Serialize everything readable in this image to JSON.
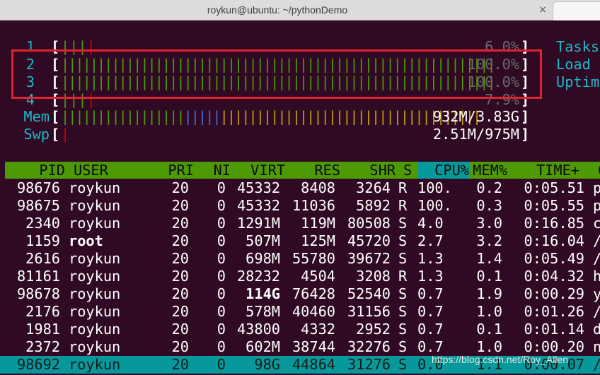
{
  "window": {
    "title": "roykun@ubuntu: ~/pythonDemo",
    "close_glyph": "×"
  },
  "meters": [
    {
      "label": "1",
      "bars_green": "|||",
      "bars_red": "|",
      "bars_blue": "",
      "bars_yellow": "",
      "value": "6.0%",
      "bright": false,
      "side": "Tasks"
    },
    {
      "label": "2",
      "bars_green": "||||||||||||||||||||||||||||||||||||||||||||||||||||||||||||",
      "bars_red": "",
      "bars_blue": "",
      "bars_yellow": "",
      "value": "100.0%",
      "bright": false,
      "side": "Load"
    },
    {
      "label": "3",
      "bars_green": "||||||||||||||||||||||||||||||||||||||||||||||||||||||||||||",
      "bars_red": "",
      "bars_blue": "",
      "bars_yellow": "",
      "value": "100.0%",
      "bright": false,
      "side": "Uptim"
    },
    {
      "label": "4",
      "bars_green": "|||",
      "bars_red": "|",
      "bars_blue": "",
      "bars_yellow": "",
      "value": "7.9%",
      "bright": false,
      "side": ""
    },
    {
      "label": "Mem",
      "bars_green": "|||||||||||||||||",
      "bars_red": "",
      "bars_blue": "|||||",
      "bars_yellow": "||||||||||||||||||||||||||||||||||||",
      "value": "932M/3.83G",
      "bright": true,
      "side": ""
    },
    {
      "label": "Swp",
      "bars_green": "",
      "bars_red": "|",
      "bars_blue": "",
      "bars_yellow": "",
      "value": "2.51M/975M",
      "bright": true,
      "side": ""
    }
  ],
  "columns": {
    "pid": "PID",
    "user": "USER",
    "pri": "PRI",
    "ni": "NI",
    "virt": "VIRT",
    "res": "RES",
    "shr": "SHR",
    "s": "S",
    "cpu": "CPU%",
    "mem": "MEM%",
    "time": "TIME+",
    "cmd": "C"
  },
  "processes": [
    {
      "pid": "98676",
      "user": "roykun",
      "pri": "20",
      "ni": "0",
      "virt_a": "45",
      "virt_b": "332",
      "res_a": "8",
      "res_b": "408",
      "shr_a": "3",
      "shr_b": "264",
      "s": "R",
      "cpu": "100.",
      "mem": "0.2",
      "time": "0:05.51",
      "cmd": "p"
    },
    {
      "pid": "98675",
      "user": "roykun",
      "pri": "20",
      "ni": "0",
      "virt_a": "45",
      "virt_b": "332",
      "res_a": "11",
      "res_b": "036",
      "shr_a": "5",
      "shr_b": "892",
      "s": "R",
      "cpu": "100.",
      "mem": "0.3",
      "time": "0:05.55",
      "cmd": "p"
    },
    {
      "pid": "2340",
      "user": "roykun",
      "pri": "20",
      "ni": "0",
      "virt_a": "1291M",
      "virt_b": "",
      "res_a": "119M",
      "res_b": "",
      "shr_a": "80",
      "shr_b": "508",
      "s": "S",
      "cpu": "4.0",
      "mem": "3.0",
      "time": "0:16.85",
      "cmd": "c"
    },
    {
      "pid": "1159",
      "user": "root",
      "pri": "20",
      "ni": "0",
      "virt_a": "507M",
      "virt_b": "",
      "res_a": "125M",
      "res_b": "",
      "shr_a": "45",
      "shr_b": "720",
      "s": "S",
      "cpu": "2.7",
      "mem": "3.2",
      "time": "0:16.04",
      "cmd": "/"
    },
    {
      "pid": "2616",
      "user": "roykun",
      "pri": "20",
      "ni": "0",
      "virt_a": "698M",
      "virt_b": "",
      "res_a": "55",
      "res_b": "780",
      "shr_a": "39",
      "shr_b": "672",
      "s": "S",
      "cpu": "1.3",
      "mem": "1.4",
      "time": "0:05.49",
      "cmd": "/"
    },
    {
      "pid": "81161",
      "user": "roykun",
      "pri": "20",
      "ni": "0",
      "virt_a": "28",
      "virt_b": "232",
      "res_a": "4",
      "res_b": "504",
      "shr_a": "3",
      "shr_b": "208",
      "s": "R",
      "cpu": "1.3",
      "mem": "0.1",
      "time": "0:04.32",
      "cmd": "h"
    },
    {
      "pid": "98678",
      "user": "roykun",
      "pri": "20",
      "ni": "0",
      "virt_a": "114G",
      "virt_b": "",
      "res_a": "76",
      "res_b": "428",
      "shr_a": "52",
      "shr_b": "540",
      "s": "S",
      "cpu": "0.7",
      "mem": "1.9",
      "time": "0:00.29",
      "cmd": "y"
    },
    {
      "pid": "2176",
      "user": "roykun",
      "pri": "20",
      "ni": "0",
      "virt_a": "578M",
      "virt_b": "",
      "res_a": "40",
      "res_b": "460",
      "shr_a": "31",
      "shr_b": "156",
      "s": "S",
      "cpu": "0.7",
      "mem": "1.0",
      "time": "0:01.26",
      "cmd": "/"
    },
    {
      "pid": "1981",
      "user": "roykun",
      "pri": "20",
      "ni": "0",
      "virt_a": "43",
      "virt_b": "800",
      "res_a": "4",
      "res_b": "332",
      "shr_a": "2",
      "shr_b": "952",
      "s": "S",
      "cpu": "0.7",
      "mem": "0.1",
      "time": "0:01.14",
      "cmd": "d"
    },
    {
      "pid": "2372",
      "user": "roykun",
      "pri": "20",
      "ni": "0",
      "virt_a": "602M",
      "virt_b": "",
      "res_a": "38",
      "res_b": "744",
      "shr_a": "32",
      "shr_b": "276",
      "s": "S",
      "cpu": "0.7",
      "mem": "1.0",
      "time": "0:00.20",
      "cmd": "n"
    },
    {
      "pid": "98692",
      "user": "roykun",
      "pri": "20",
      "ni": "0",
      "virt_a": "98G",
      "virt_b": "",
      "res_a": "44864",
      "res_b": "",
      "shr_a": "31276",
      "shr_b": "",
      "s": "S",
      "cpu": "0.0",
      "mem": "1.1",
      "time": "0:00.07",
      "cmd": "/"
    }
  ],
  "watermark": "https://blog.csdn.net/Roy_Allen"
}
